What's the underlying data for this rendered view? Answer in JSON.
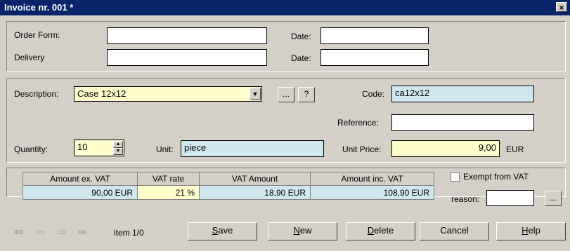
{
  "window": {
    "title": "Invoice nr. 001  *",
    "close_icon": "×"
  },
  "header": {
    "order_form_label": "Order Form:",
    "order_form_value": "",
    "order_date_label": "Date:",
    "order_date_value": "",
    "delivery_label": "Delivery",
    "delivery_value": "",
    "delivery_date_label": "Date:",
    "delivery_date_value": ""
  },
  "item": {
    "description_label": "Description:",
    "description_value": "Case 12x12",
    "browse_label": "...",
    "help_label": "?",
    "code_label": "Code:",
    "code_value": "ca12x12",
    "reference_label": "Reference:",
    "reference_value": "",
    "quantity_label": "Quantity:",
    "quantity_value": "10",
    "unit_label": "Unit:",
    "unit_value": "piece",
    "unit_price_label": "Unit Price:",
    "unit_price_value": "9,00",
    "currency": "EUR"
  },
  "vat": {
    "columns": [
      "Amount ex. VAT",
      "VAT rate",
      "VAT Amount",
      "Amount inc. VAT"
    ],
    "row": [
      "90,00 EUR",
      "21 %",
      "18,90 EUR",
      "108,90 EUR"
    ],
    "exempt_label": "Exempt from VAT",
    "exempt_checked": false,
    "reason_label": "reason:",
    "reason_value": "",
    "reason_browse_label": "..."
  },
  "navigation": {
    "first_icon": "⇚",
    "prev_icon": "⇦",
    "next_icon": "⇨",
    "last_icon": "⇛",
    "item_counter": "item 1/0"
  },
  "buttons": {
    "save_u": "S",
    "save_rest": "ave",
    "new_u": "N",
    "new_rest": "ew",
    "delete_u": "D",
    "delete_rest": "elete",
    "cancel": "Cancel",
    "help_u": "H",
    "help_rest": "elp"
  },
  "colors": {
    "title_bar": "#0a246a",
    "face": "#d4d0c8",
    "cyan_field": "#cfe8f0",
    "yellow_field": "#ffffcc"
  }
}
